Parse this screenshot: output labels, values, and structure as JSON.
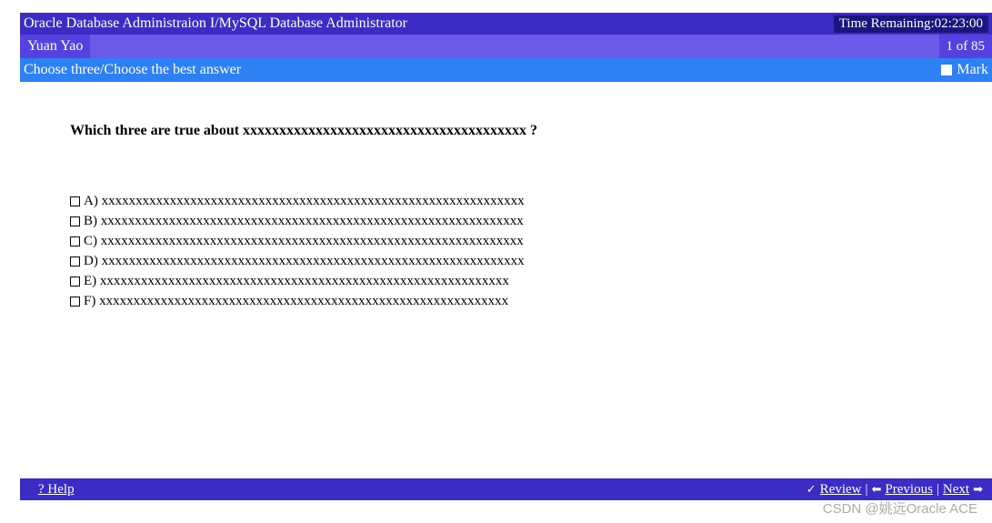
{
  "header": {
    "title": "Oracle Database Administraion I/MySQL Database Administrator",
    "time_label": "Time Remaining:",
    "time_value": "02:23:00"
  },
  "candidate": {
    "name": "Yuan Yao",
    "progress": "1 of 85"
  },
  "instruction": {
    "text": "Choose three/Choose the best answer",
    "mark_label": "Mark"
  },
  "question": {
    "text": "Which three are true about xxxxxxxxxxxxxxxxxxxxxxxxxxxxxxxxxxxxxxx ?",
    "options": [
      {
        "label": "A)",
        "text": "xxxxxxxxxxxxxxxxxxxxxxxxxxxxxxxxxxxxxxxxxxxxxxxxxxxxxxxxxxxxxx"
      },
      {
        "label": "B)",
        "text": "xxxxxxxxxxxxxxxxxxxxxxxxxxxxxxxxxxxxxxxxxxxxxxxxxxxxxxxxxxxxxx"
      },
      {
        "label": "C)",
        "text": "xxxxxxxxxxxxxxxxxxxxxxxxxxxxxxxxxxxxxxxxxxxxxxxxxxxxxxxxxxxxxx"
      },
      {
        "label": "D)",
        "text": "xxxxxxxxxxxxxxxxxxxxxxxxxxxxxxxxxxxxxxxxxxxxxxxxxxxxxxxxxxxxxx"
      },
      {
        "label": "E)",
        "text": "xxxxxxxxxxxxxxxxxxxxxxxxxxxxxxxxxxxxxxxxxxxxxxxxxxxxxxxxxxxx"
      },
      {
        "label": "F)",
        "text": "xxxxxxxxxxxxxxxxxxxxxxxxxxxxxxxxxxxxxxxxxxxxxxxxxxxxxxxxxxxx"
      }
    ]
  },
  "footer": {
    "help": "? Help",
    "review": "Review",
    "previous": "Previous",
    "next": "Next",
    "sep": " | "
  },
  "watermark": "CSDN @姚远Oracle ACE"
}
